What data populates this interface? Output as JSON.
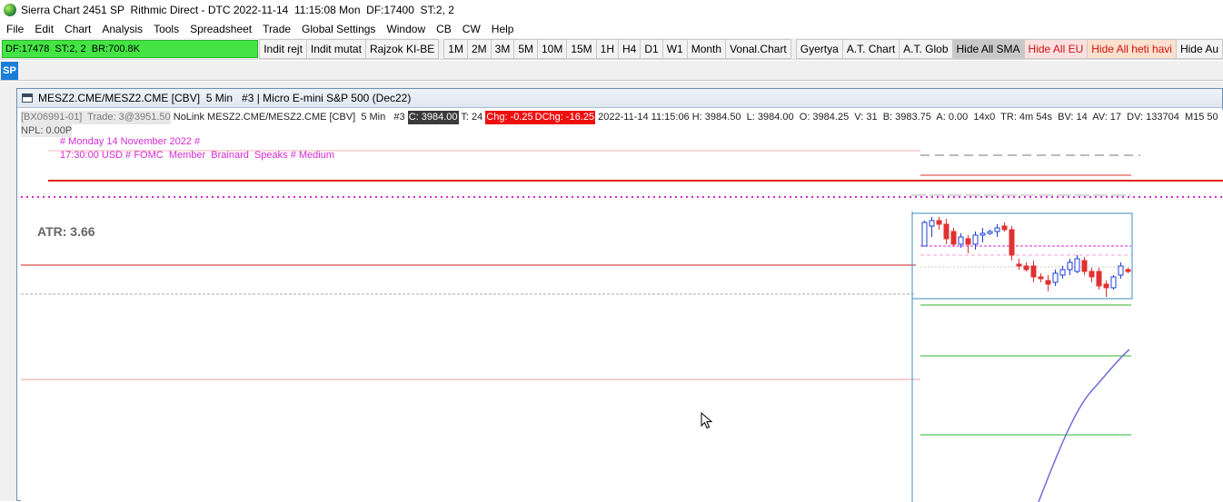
{
  "window": {
    "title": "Sierra Chart 2451 SP  Rithmic Direct - DTC 2022-11-14  11:15:08 Mon  DF:17400  ST:2, 2"
  },
  "menu": [
    "File",
    "Edit",
    "Chart",
    "Analysis",
    "Tools",
    "Spreadsheet",
    "Trade",
    "Global Settings",
    "Window",
    "CB",
    "CW",
    "Help"
  ],
  "toolbar": {
    "status_text": "DF:17478  ST:2, 2  BR:700.8K",
    "status_color": "#44e444",
    "buttons": [
      {
        "label": "Indit rejt",
        "style": "normal"
      },
      {
        "label": "Indit mutat",
        "style": "normal"
      },
      {
        "label": "Rajzok KI-BE",
        "style": "normal"
      },
      {
        "label": "1M",
        "style": "gap"
      },
      {
        "label": "2M",
        "style": "normal"
      },
      {
        "label": "3M",
        "style": "normal"
      },
      {
        "label": "5M",
        "style": "normal"
      },
      {
        "label": "10M",
        "style": "normal"
      },
      {
        "label": "15M",
        "style": "normal"
      },
      {
        "label": "1H",
        "style": "normal"
      },
      {
        "label": "H4",
        "style": "normal"
      },
      {
        "label": "D1",
        "style": "normal"
      },
      {
        "label": "W1",
        "style": "normal"
      },
      {
        "label": "Month",
        "style": "normal"
      },
      {
        "label": "Vonal.Chart",
        "style": "normal"
      },
      {
        "label": "Gyertya",
        "style": "gap"
      },
      {
        "label": "A.T. Chart",
        "style": "normal"
      },
      {
        "label": "A.T. Glob",
        "style": "normal"
      },
      {
        "label": "Hide All SMA",
        "style": "gray"
      },
      {
        "label": "Hide All EU",
        "style": "pink"
      },
      {
        "label": "Hide All heti havi",
        "style": "peach"
      },
      {
        "label": "Hide Au",
        "style": "normal"
      }
    ]
  },
  "tabs": [
    {
      "label": "SP"
    }
  ],
  "chart": {
    "title": "MESZ2.CME/MESZ2.CME [CBV]  5 Min   #3 | Micro E-mini S&P 500 (Dec22)",
    "info": {
      "account": "[BX06991-01]  Trade: 3@3951.50",
      "symbol": " NoLink MESZ2.CME/MESZ2.CME [CBV]  5 Min   #3 ",
      "close": "C: 3984.00",
      "trades": " T: 24 ",
      "chg": "Chg: -0.25",
      "dchg": "DChg: -16.25",
      "rest": " 2022-11-14 11:15:06 H: 3984.50  L: 3984.00  O: 3984.25  V: 31  B: 3983.75  A: 0.00  14x0  TR: 4m 54s  BV: 14  AV: 17  DV: 133704  M15 50  Mo"
    },
    "npl": "NPL: 0.00P",
    "event_date": "# Monday 14 November 2022 #",
    "event_text": "17:30:00 USD # FOMC  Member  Brainard  Speaks # Medium",
    "atr": "ATR: 3.66",
    "colors": {
      "up_candle": "#1f3fd6",
      "down_candle": "#e03030",
      "support_line": "#2fb52f",
      "curve": "#6d6dd9",
      "event_text": "#d42ad4"
    }
  }
}
